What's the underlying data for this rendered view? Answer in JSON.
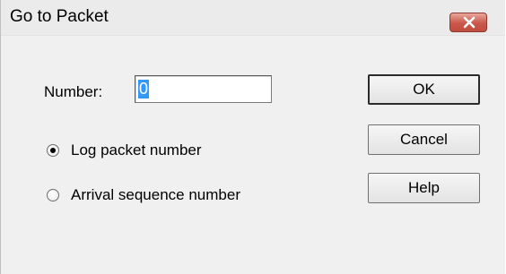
{
  "window": {
    "title": "Go to Packet",
    "close_icon": "close-icon"
  },
  "form": {
    "number_label": "Number:",
    "number_value": "0"
  },
  "options": [
    {
      "label": "Log packet number",
      "checked": true
    },
    {
      "label": "Arrival sequence number",
      "checked": false
    }
  ],
  "buttons": {
    "ok": "OK",
    "cancel": "Cancel",
    "help": "Help"
  },
  "colors": {
    "close_button": "#c9574a",
    "selection": "#3399ff"
  }
}
